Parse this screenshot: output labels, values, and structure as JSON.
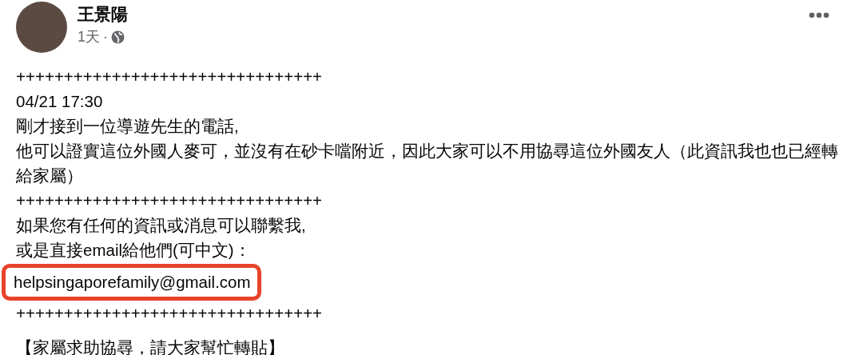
{
  "author": {
    "name": "王景陽",
    "time": "1天",
    "separator": "·"
  },
  "post": {
    "lines": [
      {
        "kind": "text",
        "text": "++++++++++++++++++++++++++++++++"
      },
      {
        "kind": "text",
        "text": "04/21 17:30"
      },
      {
        "kind": "text",
        "text": "剛才接到一位導遊先生的電話,"
      },
      {
        "kind": "text",
        "text": "他可以證實這位外國人麥可，並沒有在砂卡噹附近，因此大家可以不用協尋這位外國友人（此資訊我也也已經轉給家屬）"
      },
      {
        "kind": "text",
        "text": "++++++++++++++++++++++++++++++++"
      },
      {
        "kind": "text",
        "text": "如果您有任何的資訊或消息可以聯繫我,"
      },
      {
        "kind": "text",
        "text": "或是直接email給他們(可中文)："
      },
      {
        "kind": "highlight",
        "text": "helpsingaporefamily@gmail.com"
      },
      {
        "kind": "text",
        "text": "++++++++++++++++++++++++++++++++"
      },
      {
        "kind": "spaced",
        "text": "【家屬求助協尋，請大家幫忙轉貼】"
      }
    ]
  }
}
